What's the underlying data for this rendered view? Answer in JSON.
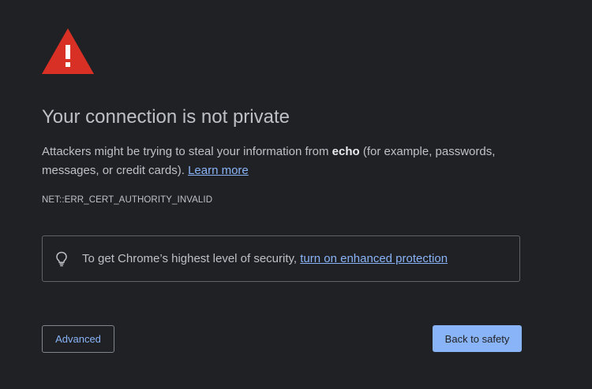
{
  "colors": {
    "background": "#202124",
    "text": "#bdc1c6",
    "link": "#8ab4f8",
    "warning_red": "#d93025",
    "primary_button_bg": "#8ab4f8",
    "box_border": "#5f6368"
  },
  "icons": {
    "warning": "warning-triangle-icon",
    "tip": "lightbulb-icon"
  },
  "title": "Your connection is not private",
  "message": {
    "before_host": "Attackers might be trying to steal your information from ",
    "host": "echo",
    "after_host": " (for example, passwords, messages, or credit cards). ",
    "learn_more_link": "Learn more"
  },
  "error_code": "NET::ERR_CERT_AUTHORITY_INVALID",
  "enhanced_protection": {
    "text": "To get Chrome’s highest level of security, ",
    "link": "turn on enhanced protection"
  },
  "buttons": {
    "advanced": "Advanced",
    "back_to_safety": "Back to safety"
  }
}
